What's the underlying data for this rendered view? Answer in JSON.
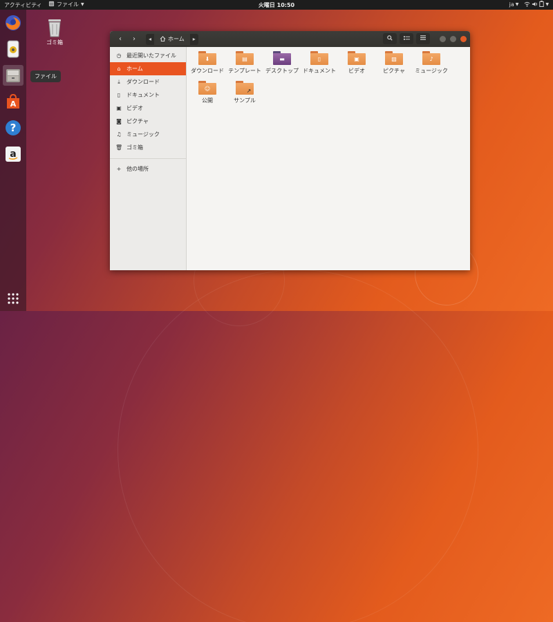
{
  "topbar": {
    "activities": "アクティビティ",
    "app_menu": "ファイル",
    "clock": "火曜日 10:50",
    "language": "ja"
  },
  "dock": {
    "tooltip": "ファイル",
    "items": [
      "firefox",
      "rhythmbox",
      "files",
      "software",
      "help",
      "amazon"
    ]
  },
  "desktop": {
    "trash_label": "ゴミ箱"
  },
  "window": {
    "path_home": "ホーム",
    "sidebar": {
      "recent": "最近開いたファイル",
      "home": "ホーム",
      "downloads": "ダウンロード",
      "documents": "ドキュメント",
      "videos": "ビデオ",
      "pictures": "ピクチャ",
      "music": "ミュージック",
      "trash": "ゴミ箱",
      "other": "他の場所"
    },
    "files": [
      "ダウンロード",
      "テンプレート",
      "デスクトップ",
      "ドキュメント",
      "ビデオ",
      "ピクチャ",
      "ミュージック",
      "公開",
      "サンプル"
    ]
  },
  "colors": {
    "accent": "#e95420",
    "folder": "#e58d45"
  }
}
